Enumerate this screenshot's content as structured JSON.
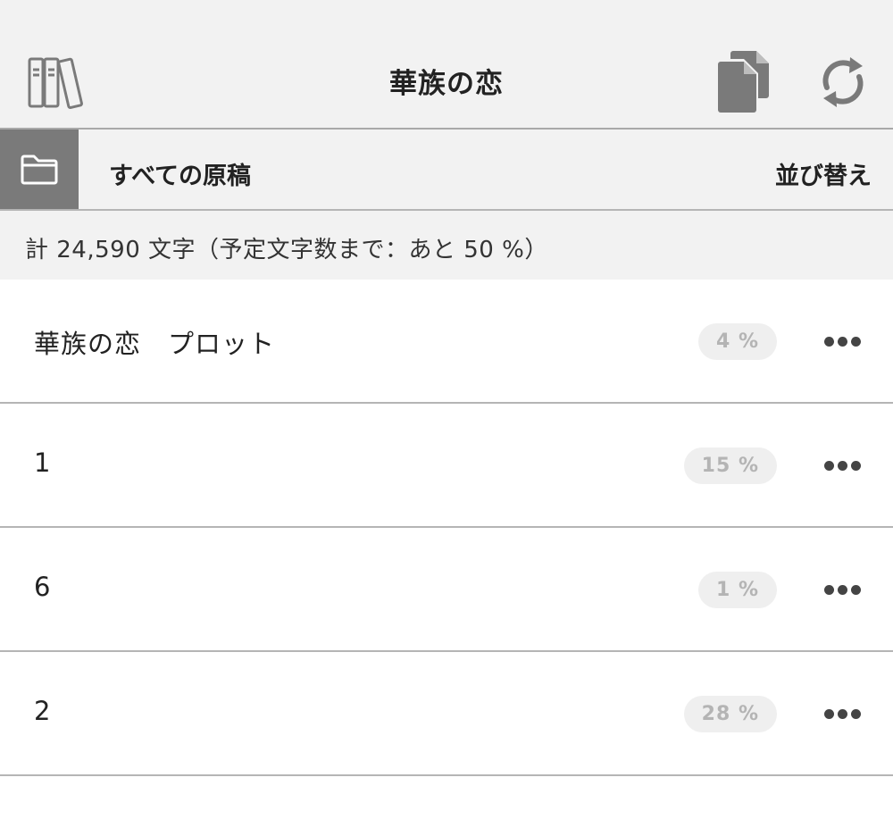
{
  "header": {
    "title": "華族の恋",
    "icons": {
      "left": "library-icon",
      "right": [
        "copy-documents-icon",
        "sync-icon"
      ]
    }
  },
  "folder": {
    "icon": "folder-icon",
    "name": "すべての原稿",
    "sort_label": "並び替え"
  },
  "summary": {
    "text": "計 24,590 文字（予定文字数まで：あと 50 %）"
  },
  "manuscripts": [
    {
      "title": "華族の恋　プロット",
      "progress": "4 %"
    },
    {
      "title": "1",
      "progress": "15 %"
    },
    {
      "title": "6",
      "progress": "1 %"
    },
    {
      "title": "2",
      "progress": "28 %"
    }
  ],
  "colors": {
    "bar_background": "#f2f2f2",
    "folder_button": "#7a7a7a",
    "icon_gray": "#7a7a7a",
    "badge_background": "#efefef",
    "badge_text": "#b4b4b4"
  }
}
